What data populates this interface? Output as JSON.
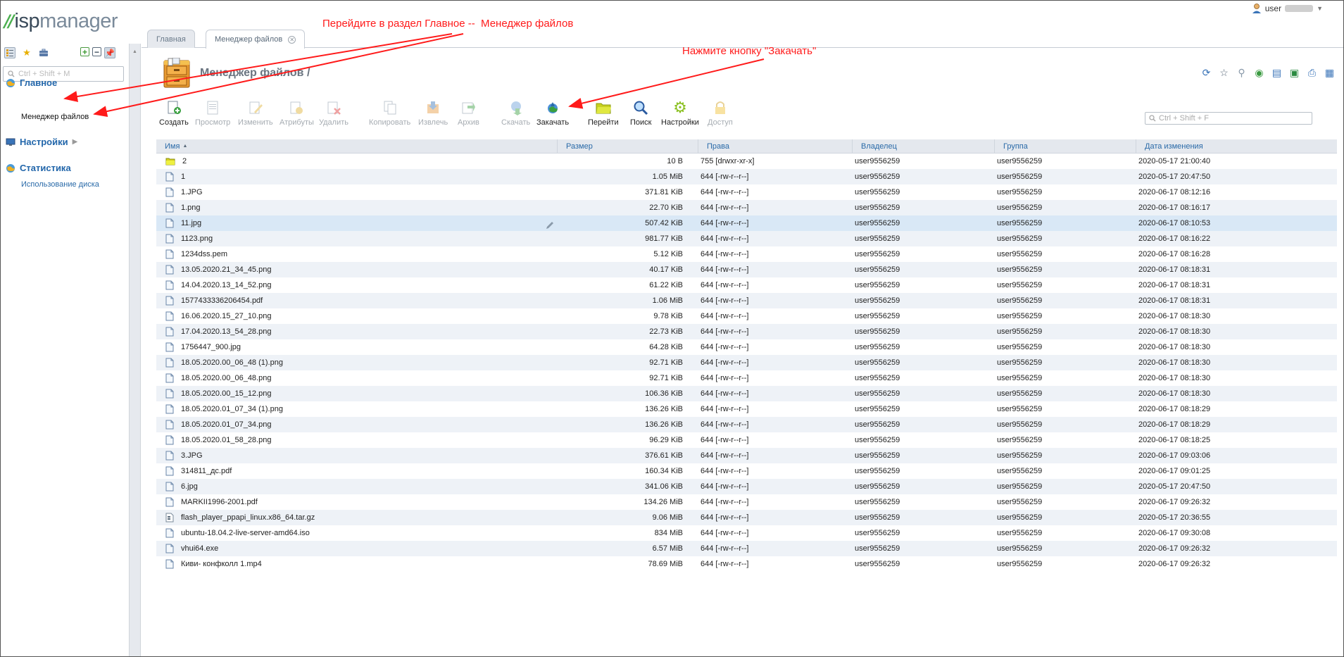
{
  "app": {
    "logo_mark": "//",
    "logo_text_a": "isp",
    "logo_text_b": "manager",
    "user": "user"
  },
  "left_panel": {
    "search_placeholder": "Ctrl + Shift + M",
    "groups": [
      {
        "label": "Главное",
        "icon": "globe-icon",
        "sub": [
          {
            "label": "Менеджер файлов"
          }
        ]
      },
      {
        "label": "Настройки",
        "icon": "monitor-icon",
        "sub": []
      },
      {
        "label": "Статистика",
        "icon": "globe-icon",
        "sub": [
          {
            "label": "Использование диска"
          }
        ]
      }
    ]
  },
  "tabs": [
    {
      "label": "Главная"
    },
    {
      "label": "Менеджер файлов",
      "closable": true
    }
  ],
  "page": {
    "title": "Менеджер файлов /"
  },
  "toolbar": [
    {
      "label": "Создать",
      "icon": "create-icon",
      "enabled": true
    },
    {
      "label": "Просмотр",
      "icon": "view-icon",
      "enabled": false
    },
    {
      "label": "Изменить",
      "icon": "edit-icon",
      "enabled": false
    },
    {
      "label": "Атрибуты",
      "icon": "attributes-icon",
      "enabled": false
    },
    {
      "label": "Удалить",
      "icon": "delete-icon",
      "enabled": false
    },
    {
      "label": "Копировать",
      "icon": "copy-icon",
      "enabled": false
    },
    {
      "label": "Извлечь",
      "icon": "extract-icon",
      "enabled": false
    },
    {
      "label": "Архив",
      "icon": "archive-icon",
      "enabled": false
    },
    {
      "label": "Скачать",
      "icon": "download-icon",
      "enabled": false
    },
    {
      "label": "Закачать",
      "icon": "upload-icon",
      "enabled": true
    },
    {
      "label": "Перейти",
      "icon": "folder-go-icon",
      "enabled": true
    },
    {
      "label": "Поиск",
      "icon": "search-icon",
      "enabled": true
    },
    {
      "label": "Настройки",
      "icon": "settings-gear-icon",
      "enabled": true
    },
    {
      "label": "Доступ",
      "icon": "lock-icon",
      "enabled": false
    }
  ],
  "table_search_placeholder": "Ctrl + Shift + F",
  "table": {
    "columns": [
      "Имя",
      "Размер",
      "Права",
      "Владелец",
      "Группа",
      "Дата изменения"
    ],
    "rows": [
      {
        "name": "2",
        "type": "folder",
        "size": "10 B",
        "perm": "755 [drwxr-xr-x]",
        "owner": "user9556259",
        "group": "user9556259",
        "date": "2020-05-17 21:00:40"
      },
      {
        "name": "1",
        "type": "file",
        "size": "1.05 MiB",
        "perm": "644 [-rw-r--r--]",
        "owner": "user9556259",
        "group": "user9556259",
        "date": "2020-05-17 20:47:50"
      },
      {
        "name": "1.JPG",
        "type": "file",
        "size": "371.81 KiB",
        "perm": "644 [-rw-r--r--]",
        "owner": "user9556259",
        "group": "user9556259",
        "date": "2020-06-17 08:12:16"
      },
      {
        "name": "1.png",
        "type": "file",
        "size": "22.70 KiB",
        "perm": "644 [-rw-r--r--]",
        "owner": "user9556259",
        "group": "user9556259",
        "date": "2020-06-17 08:16:17"
      },
      {
        "name": "11.jpg",
        "type": "file",
        "size": "507.42 KiB",
        "perm": "644 [-rw-r--r--]",
        "owner": "user9556259",
        "group": "user9556259",
        "date": "2020-06-17 08:10:53",
        "selected": true
      },
      {
        "name": "1123.png",
        "type": "file",
        "size": "981.77 KiB",
        "perm": "644 [-rw-r--r--]",
        "owner": "user9556259",
        "group": "user9556259",
        "date": "2020-06-17 08:16:22"
      },
      {
        "name": "1234dss.pem",
        "type": "file",
        "size": "5.12 KiB",
        "perm": "644 [-rw-r--r--]",
        "owner": "user9556259",
        "group": "user9556259",
        "date": "2020-06-17 08:16:28"
      },
      {
        "name": "13.05.2020.21_34_45.png",
        "type": "file",
        "size": "40.17 KiB",
        "perm": "644 [-rw-r--r--]",
        "owner": "user9556259",
        "group": "user9556259",
        "date": "2020-06-17 08:18:31"
      },
      {
        "name": "14.04.2020.13_14_52.png",
        "type": "file",
        "size": "61.22 KiB",
        "perm": "644 [-rw-r--r--]",
        "owner": "user9556259",
        "group": "user9556259",
        "date": "2020-06-17 08:18:31"
      },
      {
        "name": "1577433336206454.pdf",
        "type": "file",
        "size": "1.06 MiB",
        "perm": "644 [-rw-r--r--]",
        "owner": "user9556259",
        "group": "user9556259",
        "date": "2020-06-17 08:18:31"
      },
      {
        "name": "16.06.2020.15_27_10.png",
        "type": "file",
        "size": "9.78 KiB",
        "perm": "644 [-rw-r--r--]",
        "owner": "user9556259",
        "group": "user9556259",
        "date": "2020-06-17 08:18:30"
      },
      {
        "name": "17.04.2020.13_54_28.png",
        "type": "file",
        "size": "22.73 KiB",
        "perm": "644 [-rw-r--r--]",
        "owner": "user9556259",
        "group": "user9556259",
        "date": "2020-06-17 08:18:30"
      },
      {
        "name": "1756447_900.jpg",
        "type": "file",
        "size": "64.28 KiB",
        "perm": "644 [-rw-r--r--]",
        "owner": "user9556259",
        "group": "user9556259",
        "date": "2020-06-17 08:18:30"
      },
      {
        "name": "18.05.2020.00_06_48 (1).png",
        "type": "file",
        "size": "92.71 KiB",
        "perm": "644 [-rw-r--r--]",
        "owner": "user9556259",
        "group": "user9556259",
        "date": "2020-06-17 08:18:30"
      },
      {
        "name": "18.05.2020.00_06_48.png",
        "type": "file",
        "size": "92.71 KiB",
        "perm": "644 [-rw-r--r--]",
        "owner": "user9556259",
        "group": "user9556259",
        "date": "2020-06-17 08:18:30"
      },
      {
        "name": "18.05.2020.00_15_12.png",
        "type": "file",
        "size": "106.36 KiB",
        "perm": "644 [-rw-r--r--]",
        "owner": "user9556259",
        "group": "user9556259",
        "date": "2020-06-17 08:18:30"
      },
      {
        "name": "18.05.2020.01_07_34 (1).png",
        "type": "file",
        "size": "136.26 KiB",
        "perm": "644 [-rw-r--r--]",
        "owner": "user9556259",
        "group": "user9556259",
        "date": "2020-06-17 08:18:29"
      },
      {
        "name": "18.05.2020.01_07_34.png",
        "type": "file",
        "size": "136.26 KiB",
        "perm": "644 [-rw-r--r--]",
        "owner": "user9556259",
        "group": "user9556259",
        "date": "2020-06-17 08:18:29"
      },
      {
        "name": "18.05.2020.01_58_28.png",
        "type": "file",
        "size": "96.29 KiB",
        "perm": "644 [-rw-r--r--]",
        "owner": "user9556259",
        "group": "user9556259",
        "date": "2020-06-17 08:18:25"
      },
      {
        "name": "3.JPG",
        "type": "file",
        "size": "376.61 KiB",
        "perm": "644 [-rw-r--r--]",
        "owner": "user9556259",
        "group": "user9556259",
        "date": "2020-06-17 09:03:06"
      },
      {
        "name": "314811_дс.pdf",
        "type": "file",
        "size": "160.34 KiB",
        "perm": "644 [-rw-r--r--]",
        "owner": "user9556259",
        "group": "user9556259",
        "date": "2020-06-17 09:01:25"
      },
      {
        "name": "6.jpg",
        "type": "file",
        "size": "341.06 KiB",
        "perm": "644 [-rw-r--r--]",
        "owner": "user9556259",
        "group": "user9556259",
        "date": "2020-05-17 20:47:50"
      },
      {
        "name": "MARKII1996-2001.pdf",
        "type": "file",
        "size": "134.26 MiB",
        "perm": "644 [-rw-r--r--]",
        "owner": "user9556259",
        "group": "user9556259",
        "date": "2020-06-17 09:26:32"
      },
      {
        "name": "flash_player_ppapi_linux.x86_64.tar.gz",
        "type": "archive",
        "size": "9.06 MiB",
        "perm": "644 [-rw-r--r--]",
        "owner": "user9556259",
        "group": "user9556259",
        "date": "2020-05-17 20:36:55"
      },
      {
        "name": "ubuntu-18.04.2-live-server-amd64.iso",
        "type": "file",
        "size": "834 MiB",
        "perm": "644 [-rw-r--r--]",
        "owner": "user9556259",
        "group": "user9556259",
        "date": "2020-06-17 09:30:08"
      },
      {
        "name": "vhui64.exe",
        "type": "file",
        "size": "6.57 MiB",
        "perm": "644 [-rw-r--r--]",
        "owner": "user9556259",
        "group": "user9556259",
        "date": "2020-06-17 09:26:32"
      },
      {
        "name": "Киви- конфколл 1.mp4",
        "type": "file",
        "size": "78.69 MiB",
        "perm": "644 [-rw-r--r--]",
        "owner": "user9556259",
        "group": "user9556259",
        "date": "2020-06-17 09:26:32"
      }
    ]
  },
  "annotations": {
    "note1": "Перейдите в раздел Главное --  Менеджер файлов",
    "note2": "Нажмите кнопку \"Закачать\"",
    "color": "#ff1a1a"
  },
  "colors": {
    "link": "#2266aa",
    "header_bg": "#e4e8ee",
    "row_alt": "#eef2f7",
    "row_selected": "#d9e8f6",
    "logo_green": "#4caf50"
  }
}
